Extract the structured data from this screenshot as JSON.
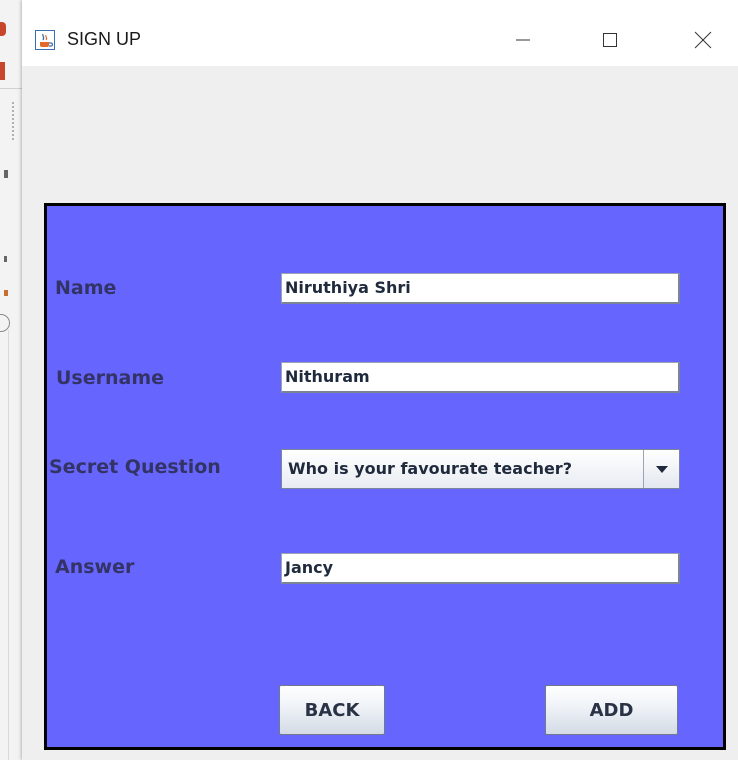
{
  "window": {
    "title": "SIGN UP"
  },
  "form": {
    "name_label": "Name",
    "name_value": "Niruthiya Shri",
    "username_label": "Username",
    "username_value": "Nithuram",
    "secret_question_label": "Secret Question",
    "secret_question_value": "Who is your favourate teacher?",
    "answer_label": "Answer",
    "answer_value": "Jancy"
  },
  "buttons": {
    "back_label": "BACK",
    "add_label": "ADD"
  },
  "colors": {
    "panel_background": "#6666ff",
    "label_text": "#333366",
    "window_background": "#efefef"
  },
  "icons": {
    "app": "java-cup-icon",
    "minimize": "minimize-icon",
    "maximize": "maximize-icon",
    "close": "close-icon",
    "dropdown": "triangle-down-icon"
  }
}
